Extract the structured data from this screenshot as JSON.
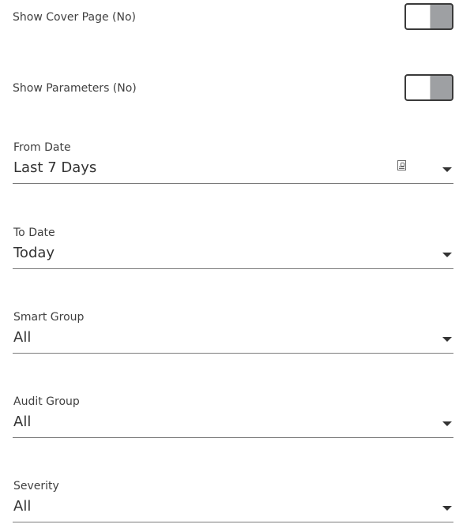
{
  "toggles": {
    "cover_page": {
      "label": "Show Cover Page (No)",
      "value": false
    },
    "parameters": {
      "label": "Show Parameters (No)",
      "value": false
    }
  },
  "fields": {
    "from_date": {
      "label": "From Date",
      "value": "Last 7 Days",
      "icon": "calendar-icon"
    },
    "to_date": {
      "label": "To Date",
      "value": "Today"
    },
    "smart_group": {
      "label": "Smart Group",
      "value": "All"
    },
    "audit_group": {
      "label": "Audit Group",
      "value": "All"
    },
    "severity": {
      "label": "Severity",
      "value": "All"
    }
  },
  "colors": {
    "toggle_track": "#9ea0a3",
    "toggle_border": "#3a3a3a",
    "underline": "#7a7a7a",
    "text": "#333333"
  }
}
